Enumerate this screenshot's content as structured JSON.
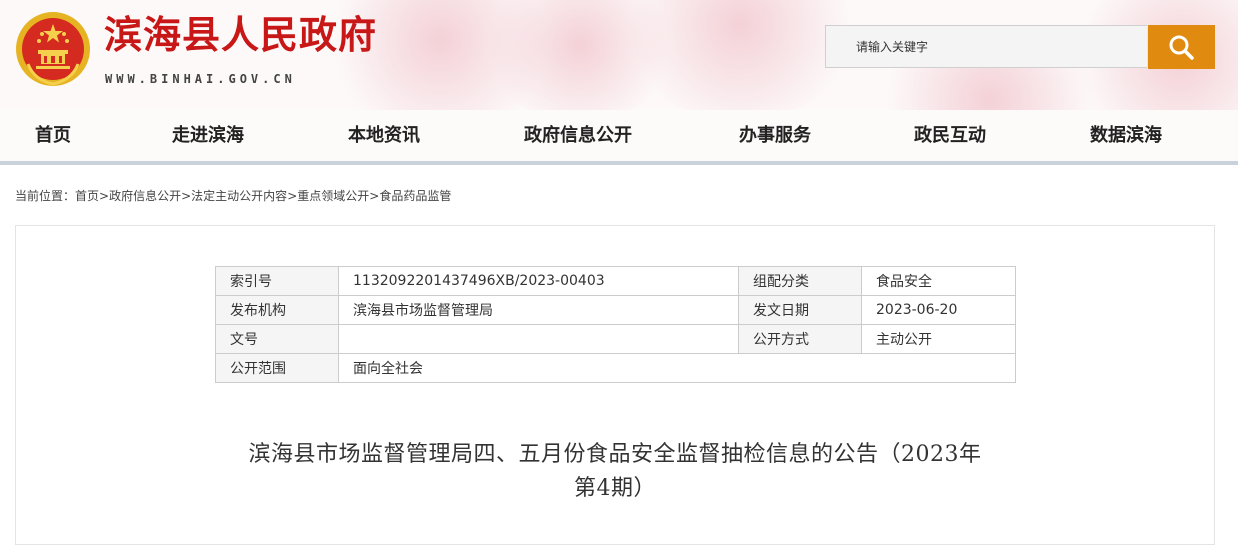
{
  "header": {
    "site_title": "滨海县人民政府",
    "site_domain": "WWW.BINHAI.GOV.CN",
    "emblem_icon": "national-emblem-icon",
    "search": {
      "placeholder": "请输入关键字",
      "button_icon": "search-icon",
      "button_color": "#e08a0f"
    },
    "brand_color": "#c81717"
  },
  "nav": {
    "items": [
      {
        "label": "首页"
      },
      {
        "label": "走进滨海"
      },
      {
        "label": "本地资讯"
      },
      {
        "label": "政府信息公开"
      },
      {
        "label": "办事服务"
      },
      {
        "label": "政民互动"
      },
      {
        "label": "数据滨海"
      }
    ]
  },
  "breadcrumb": {
    "prefix": "当前位置：",
    "separator": ">",
    "items": [
      {
        "label": "首页"
      },
      {
        "label": "政府信息公开"
      },
      {
        "label": "法定主动公开内容"
      },
      {
        "label": "重点领域公开"
      },
      {
        "label": "食品药品监管"
      }
    ]
  },
  "meta_table": {
    "rows": [
      {
        "label1": "索引号",
        "value1": "1132092201437496XB/2023-00403",
        "label2": "组配分类",
        "value2": "食品安全"
      },
      {
        "label1": "发布机构",
        "value1": "滨海县市场监督管理局",
        "label2": "发文日期",
        "value2": "2023-06-20"
      },
      {
        "label1": "文号",
        "value1": "",
        "label2": "公开方式",
        "value2": "主动公开"
      },
      {
        "label1": "公开范围",
        "value1": "面向全社会"
      }
    ]
  },
  "document": {
    "title_line1": "滨海县市场监督管理局四、五月份食品安全监督抽检信息的公告（2023年",
    "title_line2": "第4期）"
  }
}
